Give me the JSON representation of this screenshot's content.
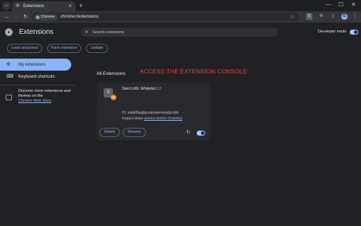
{
  "tabbar": {
    "menu_icon": "⌄",
    "tab_title": "Extensions",
    "tab_close": "✕",
    "new_tab": "+",
    "minimize": "—",
    "maximize": "☐",
    "close": "✕"
  },
  "toolbar": {
    "back": "←",
    "forward": "→",
    "reload": "↻",
    "chip_label": "Chrome",
    "url": "chrome://extensions",
    "star": "☆",
    "ext_letter": "S",
    "profile_initial": "G",
    "menu": "⋮"
  },
  "page": {
    "title": "Extensions",
    "search_placeholder": "Search extensions",
    "developer_mode_label": "Developer mode",
    "developer_mode_on": true,
    "actions": {
      "load_unpacked": "Load unpacked",
      "pack_extension": "Pack extension",
      "update": "Update"
    },
    "banner": "ACCESS THE EXTENSION CONSOLE",
    "accent_color": "#8ab4f8",
    "banner_color": "#ea4335"
  },
  "sidebar": {
    "items": [
      {
        "label": "My extensions",
        "icon": "puzzle-icon",
        "active": true
      },
      {
        "label": "Keyboard shortcuts",
        "icon": "keyboard-icon",
        "active": false
      }
    ],
    "store_text": "Discover more extensions and themes on the",
    "store_link": "Chrome Web Store"
  },
  "main": {
    "section_title": "All Extensions",
    "extension": {
      "icon_letter": "S",
      "badge": "OK",
      "name": "Strict URL Whitelist",
      "version": "1.0",
      "id_line": "ID: inniblfhgajbjcoahcienmeadjccklib",
      "inspect_prefix": "Inspect views",
      "inspect_link": "service worker (Inactive)",
      "details_label": "Details",
      "remove_label": "Remove",
      "reload_icon": "↻",
      "enabled": true
    }
  }
}
